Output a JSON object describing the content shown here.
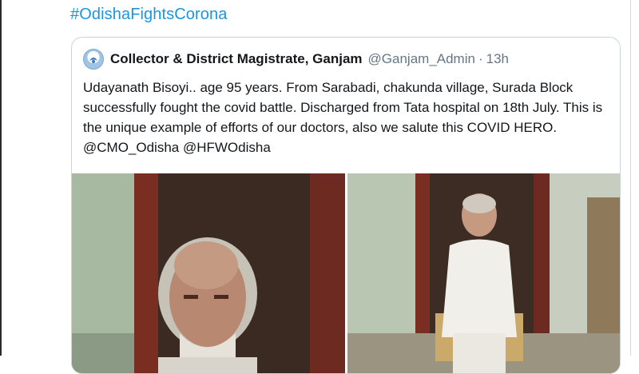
{
  "hashtag": "#OdishaFightsCorona",
  "quoted_tweet": {
    "author_name": "Collector & District Magistrate, Ganjam",
    "author_handle": "@Ganjam_Admin",
    "separator": "·",
    "time_ago": "13h",
    "text": "Udayanath  Bisoyi.. age 95 years. From Sarabadi, chakunda village, Surada Block successfully fought the covid battle. Discharged from Tata hospital on 18th July. This is the unique example of efforts of our doctors, also we salute this COVID HERO. @CMO_Odisha @HFWOdisha"
  },
  "media": {
    "count": 2
  },
  "colors": {
    "link": "#1b95e0",
    "border": "#c9d4dc",
    "secondary_text": "#657786",
    "primary_text": "#14171a"
  },
  "icons": {
    "avatar": "district-emblem-icon"
  }
}
